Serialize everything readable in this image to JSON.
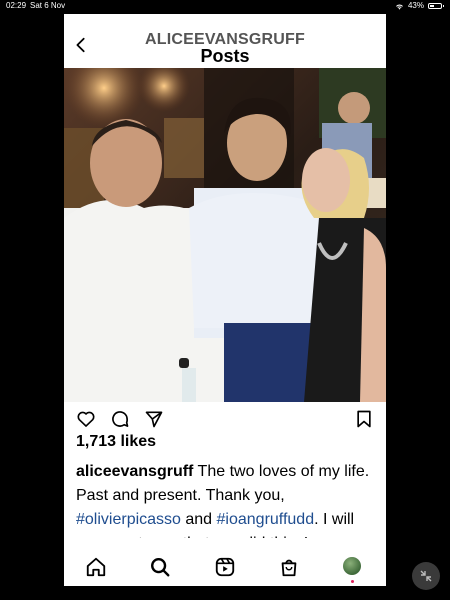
{
  "statusbar": {
    "time": "02:29",
    "date": "Sat 6 Nov",
    "battery": "43%",
    "battery_level": 0.43
  },
  "header": {
    "username": "ALICEEVANSGRUFF",
    "title": "Posts"
  },
  "post": {
    "likes": "1,713 likes",
    "caption": {
      "username": "aliceevansgruff",
      "text1": " The two loves of my life. Past and present. Thank you, ",
      "tag1": "#olivierpicasso",
      "text2": " and ",
      "tag2": "#ioangruffudd",
      "text3": ".  I will never get over that you did this. I"
    }
  },
  "icons": {
    "back": "chevron-left-icon",
    "like": "heart-icon",
    "comment": "comment-icon",
    "share": "send-icon",
    "save": "bookmark-icon",
    "home": "home-icon",
    "search": "search-icon",
    "reels": "reels-icon",
    "shop": "shop-bag-icon"
  },
  "colors": {
    "hashtag": "#1f4d8f",
    "notification_dot": "#e0245e"
  }
}
